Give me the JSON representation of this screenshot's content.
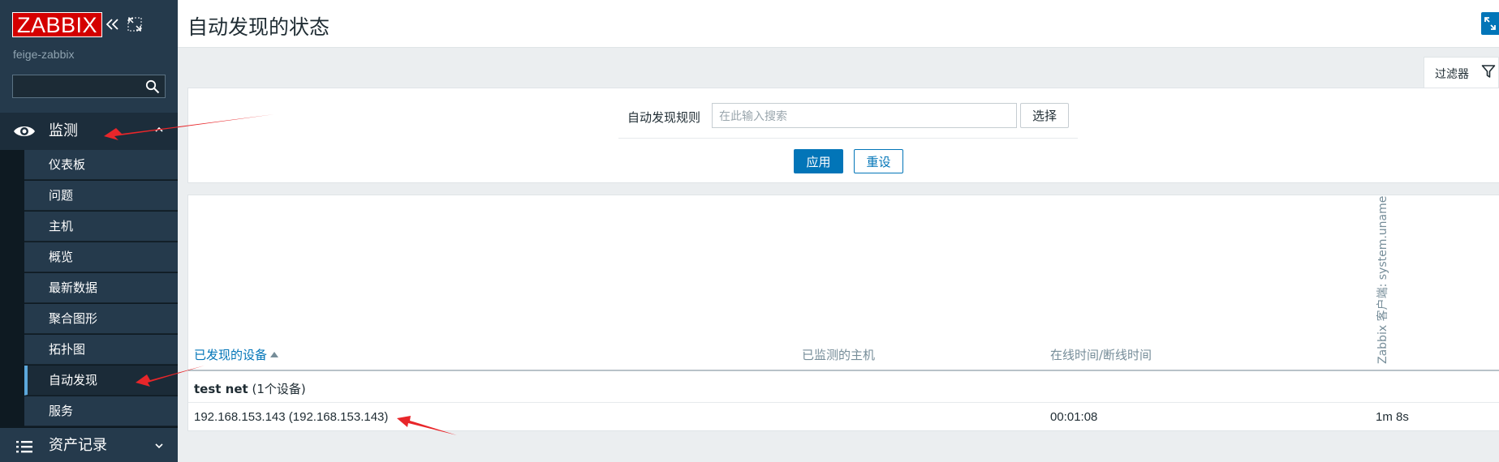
{
  "sidebar": {
    "logo_text": "ZABBIX",
    "server_name": "feige-zabbix",
    "search_placeholder": "",
    "sections": [
      {
        "label": "监测",
        "icon": "eye-icon",
        "expanded": true
      },
      {
        "label": "资产记录",
        "icon": "list-icon",
        "expanded": false
      }
    ],
    "items": [
      {
        "label": "仪表板"
      },
      {
        "label": "问题"
      },
      {
        "label": "主机"
      },
      {
        "label": "概览"
      },
      {
        "label": "最新数据"
      },
      {
        "label": "聚合图形"
      },
      {
        "label": "拓扑图"
      },
      {
        "label": "自动发现",
        "current": true
      },
      {
        "label": "服务"
      }
    ]
  },
  "header": {
    "title": "自动发现的状态"
  },
  "filter": {
    "tab_label": "过滤器",
    "rule_label": "自动发现规则",
    "rule_placeholder": "在此输入搜索",
    "rule_value": "",
    "select_label": "选择",
    "apply_label": "应用",
    "reset_label": "重设"
  },
  "table": {
    "columns": {
      "device": "已发现的设备",
      "monitored_host": "已监测的主机",
      "uptime": "在线时间/断线时间",
      "check": "Zabbix 客户端: system.uname"
    },
    "group": {
      "name": "test net",
      "count_text": "(1个设备)"
    },
    "rows": [
      {
        "device": "192.168.153.143 (192.168.153.143)",
        "monitored_host": "",
        "uptime": "00:01:08",
        "check": "1m 8s"
      }
    ]
  },
  "colors": {
    "sidebar_bg": "#253a4c",
    "brand_red": "#d40000",
    "accent_blue": "#0275b8",
    "annotation_red": "#e8262a"
  }
}
